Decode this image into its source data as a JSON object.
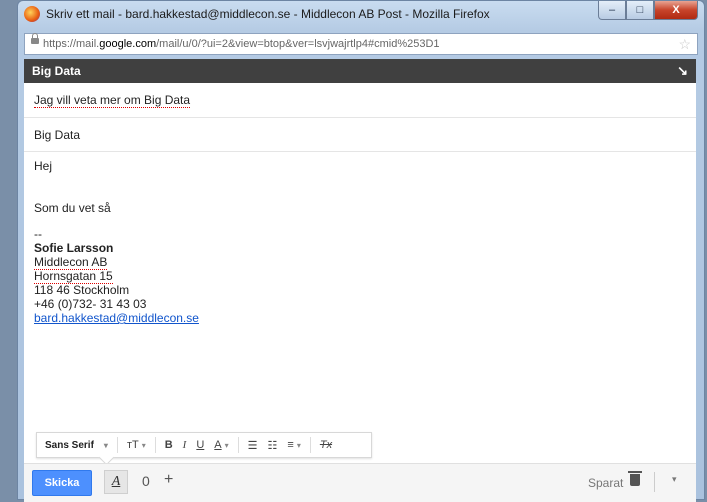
{
  "window": {
    "title": "Skriv ett mail - bard.hakkestad@middlecon.se - Middlecon AB Post - Mozilla Firefox",
    "url_prefix": "https://mail.",
    "url_domain": "google.com",
    "url_rest": "/mail/u/0/?ui=2&view=btop&ver=lsvjwajrtlp4#cmid%253D1",
    "minimize": "–",
    "maximize": "□",
    "close": "X"
  },
  "compose": {
    "header_title": "Big Data",
    "to": "Jag vill veta mer om Big Data",
    "subject": "Big Data",
    "body": {
      "line1": "Hej",
      "line2": "Som du vet så",
      "sig_dash": "--",
      "sig_name": "Sofie Larsson",
      "sig_company": "Middlecon AB",
      "sig_street": "Hornsgatan 15",
      "sig_city": "118 46 Stockholm",
      "sig_phone": "+46 (0)732- 31 43 03",
      "sig_email": "bard.hakkestad@middlecon.se"
    }
  },
  "toolbar": {
    "font": "Sans Serif",
    "size": "тT",
    "bold": "B",
    "italic": "I",
    "underline": "U",
    "text_color": "A",
    "numbered": "☰",
    "bulleted": "☷",
    "align": "≡",
    "clear": "Tx"
  },
  "bottom": {
    "send_label": "Skicka",
    "format_label": "A",
    "attach": "0",
    "plus": "+",
    "saved_label": "Sparat",
    "more": "▾"
  },
  "icons": {
    "expand": "↘",
    "star": "☆",
    "dropdown": "▾"
  }
}
